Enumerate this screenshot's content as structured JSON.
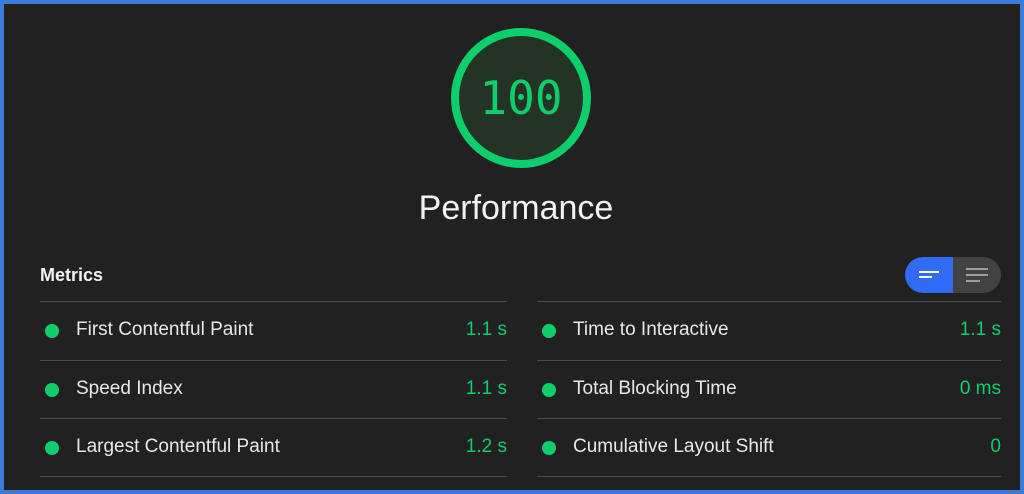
{
  "colors": {
    "pass": "#0cce6b",
    "accent": "#2f6bf5",
    "background": "#212121",
    "border": "#3a7bd5"
  },
  "gauge": {
    "score": "100",
    "score_fraction": 1.0,
    "title": "Performance"
  },
  "metrics": {
    "header": "Metrics",
    "toggle": {
      "left_icon": "lines-collapsed-icon",
      "right_icon": "lines-expanded-icon",
      "selected": "left"
    },
    "left": [
      {
        "label": "First Contentful Paint",
        "value": "1.1 s",
        "status": "pass"
      },
      {
        "label": "Speed Index",
        "value": "1.1 s",
        "status": "pass"
      },
      {
        "label": "Largest Contentful Paint",
        "value": "1.2 s",
        "status": "pass"
      }
    ],
    "right": [
      {
        "label": "Time to Interactive",
        "value": "1.1 s",
        "status": "pass"
      },
      {
        "label": "Total Blocking Time",
        "value": "0 ms",
        "status": "pass"
      },
      {
        "label": "Cumulative Layout Shift",
        "value": "0",
        "status": "pass"
      }
    ]
  }
}
